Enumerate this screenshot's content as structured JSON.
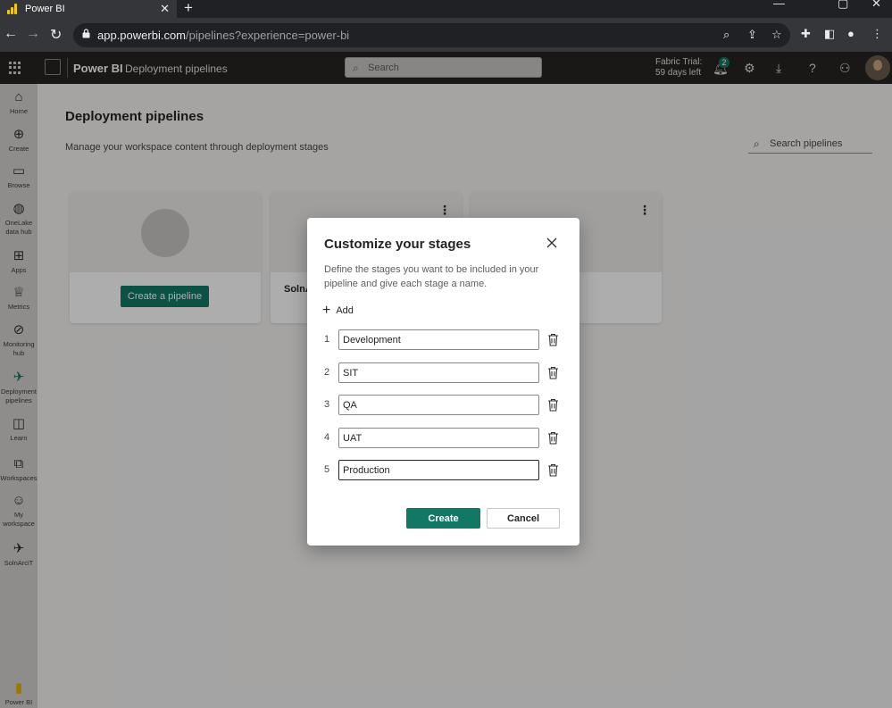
{
  "browser": {
    "tab_title": "Power BI",
    "new_tab": "+",
    "url_host": "app.powerbi.com",
    "url_path": "/pipelines?experience=power-bi"
  },
  "header": {
    "brand": "Power BI",
    "breadcrumb": "Deployment pipelines",
    "search_placeholder": "Search",
    "trial_line1": "Fabric Trial:",
    "trial_line2": "59 days left",
    "notification_count": "2"
  },
  "leftnav": {
    "items": [
      {
        "label": "Home",
        "icon": "home-icon"
      },
      {
        "label": "Create",
        "icon": "plus-circle-icon"
      },
      {
        "label": "Browse",
        "icon": "folder-icon"
      },
      {
        "label": "OneLake data hub",
        "icon": "onelake-icon"
      },
      {
        "label": "Apps",
        "icon": "apps-icon"
      },
      {
        "label": "Metrics",
        "icon": "trophy-icon"
      },
      {
        "label": "Monitoring hub",
        "icon": "monitor-icon"
      },
      {
        "label": "Deployment pipelines",
        "icon": "rocket-icon"
      },
      {
        "label": "Learn",
        "icon": "book-icon"
      },
      {
        "label": "Workspaces",
        "icon": "workspaces-icon"
      },
      {
        "label": "My workspace",
        "icon": "avatar-icon"
      },
      {
        "label": "SolnArciT",
        "icon": "rocket-icon"
      },
      {
        "label": "Power BI",
        "icon": "powerbi-logo-icon"
      }
    ]
  },
  "page": {
    "title": "Deployment pipelines",
    "subtitle": "Manage your workspace content through deployment stages",
    "search_placeholder": "Search pipelines",
    "create_pipeline_label": "Create a pipeline",
    "card2_name": "SolnA"
  },
  "dialog": {
    "title": "Customize your stages",
    "description": "Define the stages you want to be included in your pipeline and give each stage a name.",
    "add_label": "Add",
    "stages": [
      {
        "num": "1",
        "name": "Development"
      },
      {
        "num": "2",
        "name": "SIT"
      },
      {
        "num": "3",
        "name": "QA"
      },
      {
        "num": "4",
        "name": "UAT"
      },
      {
        "num": "5",
        "name": "Production"
      }
    ],
    "create_label": "Create",
    "cancel_label": "Cancel"
  },
  "colors": {
    "accent": "#117865",
    "header_bg": "#252423",
    "leftnav_bg": "#d2d0ce"
  }
}
